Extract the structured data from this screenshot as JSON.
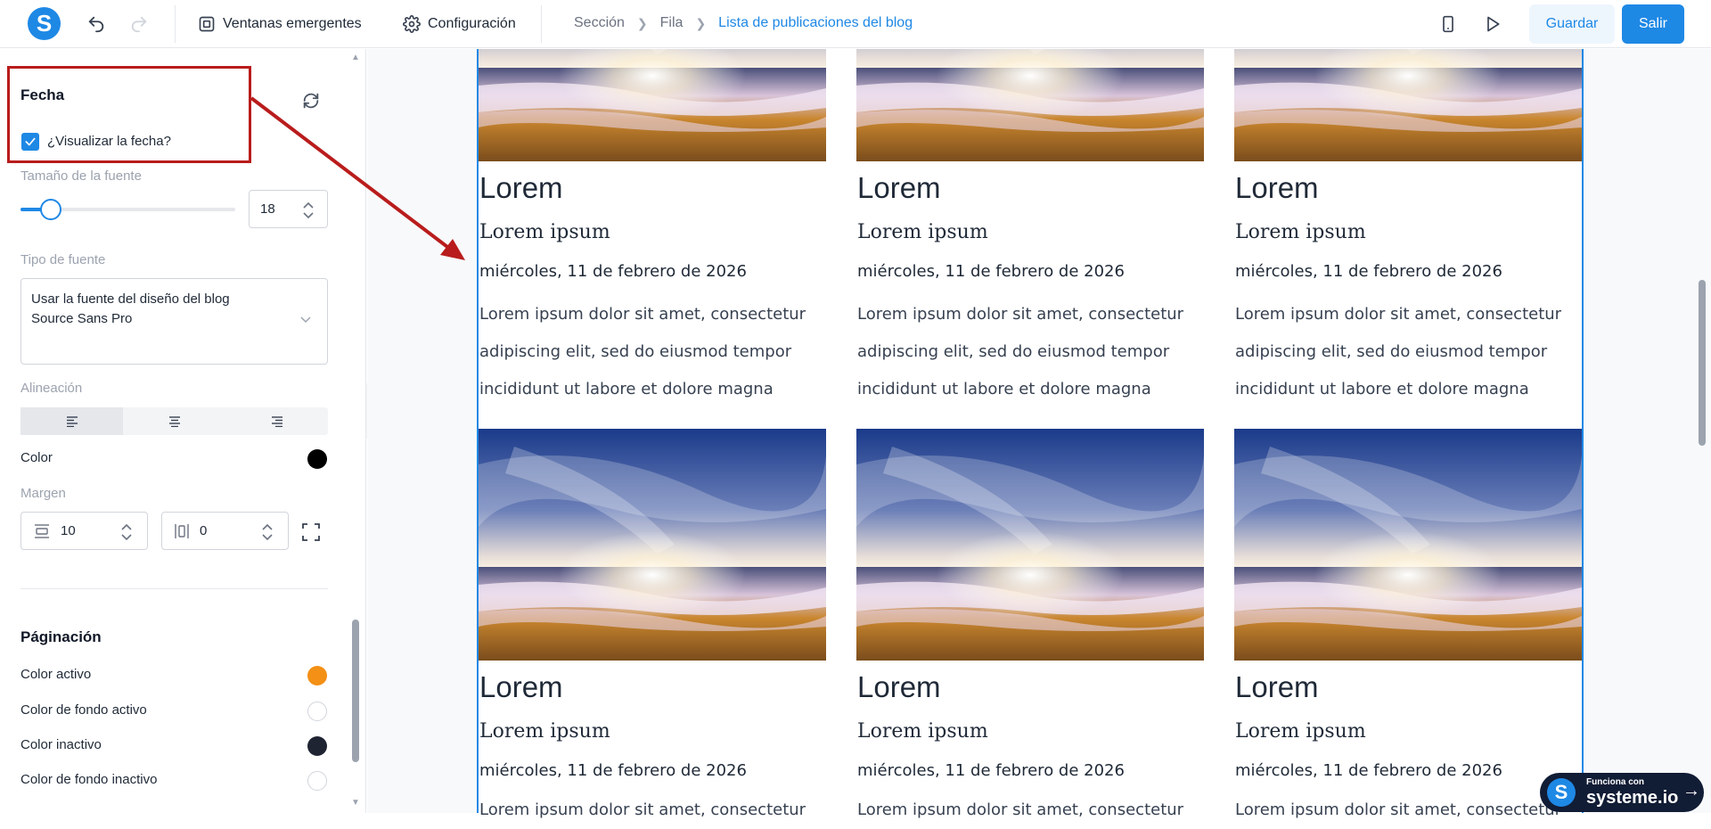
{
  "app": {
    "logo_letter": "S"
  },
  "toolbar": {
    "popups_label": "Ventanas emergentes",
    "settings_label": "Configuración",
    "save_label": "Guardar",
    "exit_label": "Salir"
  },
  "breadcrumb": [
    "Sección",
    "Fila",
    "Lista de publicaciones del blog"
  ],
  "sidebar": {
    "date_section_title": "Fecha",
    "show_date_label": "¿Visualizar la fecha?",
    "show_date_checked": true,
    "font_size_label": "Tamaño de la fuente",
    "font_size_value": "18",
    "font_type_label": "Tipo de fuente",
    "font_type_line1": "Usar la fuente del diseño del blog",
    "font_type_line2": "Source Sans Pro",
    "alignment_label": "Alineación",
    "alignment_selected": "left",
    "color_label": "Color",
    "color_value": "#000000",
    "margin_label": "Margen",
    "margin_horizontal": "10",
    "margin_vertical": "0",
    "pagination_title": "Páginación",
    "pagination_items": [
      {
        "label": "Color activo",
        "color": "#f39015"
      },
      {
        "label": "Color de fondo activo",
        "color": "#ffffff"
      },
      {
        "label": "Color inactivo",
        "color": "#1f2433"
      },
      {
        "label": "Color de fondo inactivo",
        "color": "#ffffff"
      }
    ]
  },
  "posts": [
    {
      "title": "Lorem",
      "subtitle": "Lorem ipsum",
      "date": "miércoles, 11 de febrero de 2026",
      "desc": [
        "Lorem ipsum dolor sit amet, consectetur",
        "adipiscing elit, sed do eiusmod tempor",
        "incididunt ut labore et dolore magna aliqua."
      ]
    },
    {
      "title": "Lorem",
      "subtitle": "Lorem ipsum",
      "date": "miércoles, 11 de febrero de 2026",
      "desc": [
        "Lorem ipsum dolor sit amet, consectetur",
        "adipiscing elit, sed do eiusmod tempor",
        "incididunt ut labore et dolore magna aliqua."
      ]
    },
    {
      "title": "Lorem",
      "subtitle": "Lorem ipsum",
      "date": "miércoles, 11 de febrero de 2026",
      "desc": [
        "Lorem ipsum dolor sit amet, consectetur",
        "adipiscing elit, sed do eiusmod tempor",
        "incididunt ut labore et dolore magna aliqua."
      ]
    },
    {
      "title": "Lorem",
      "subtitle": "Lorem ipsum",
      "date": "miércoles, 11 de febrero de 2026",
      "desc": [
        "Lorem ipsum dolor sit amet, consectetur"
      ]
    },
    {
      "title": "Lorem",
      "subtitle": "Lorem ipsum",
      "date": "miércoles, 11 de febrero de 2026",
      "desc": [
        "Lorem ipsum dolor sit amet, consectetur"
      ]
    },
    {
      "title": "Lorem",
      "subtitle": "Lorem ipsum",
      "date": "miércoles, 11 de febrero de 2026",
      "desc": [
        "Lorem ipsum dolor sit amet, consectetur"
      ]
    }
  ],
  "badge": {
    "small": "Funciona con",
    "big": "systeme.io",
    "logo_letter": "S"
  },
  "colors": {
    "accent": "#1e88e5",
    "highlight": "#b91c1c"
  }
}
